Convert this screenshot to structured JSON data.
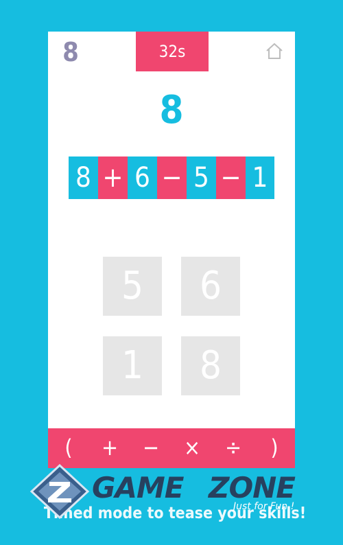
{
  "colors": {
    "background": "#16bde0",
    "accent": "#f0466f",
    "card": "#ffffff",
    "number_tile": "#16bde0",
    "number_card": "#e6e6e6",
    "score": "#8e8aae"
  },
  "header": {
    "score": "8",
    "timer": "32s",
    "home_icon": "home-icon"
  },
  "target": "8",
  "equation": [
    {
      "text": "8",
      "kind": "number"
    },
    {
      "text": "+",
      "kind": "operator"
    },
    {
      "text": "6",
      "kind": "number"
    },
    {
      "text": "−",
      "kind": "operator"
    },
    {
      "text": "5",
      "kind": "number"
    },
    {
      "text": "−",
      "kind": "operator"
    },
    {
      "text": "1",
      "kind": "number"
    }
  ],
  "number_cards": [
    "5",
    "6",
    "1",
    "8"
  ],
  "operators": [
    "(",
    "+",
    "−",
    "×",
    "÷",
    ")"
  ],
  "caption": "Timed mode to tease your skills!",
  "logo": {
    "game": "GAME",
    "zone": "ZONE",
    "tagline": "Just for Fun !"
  }
}
